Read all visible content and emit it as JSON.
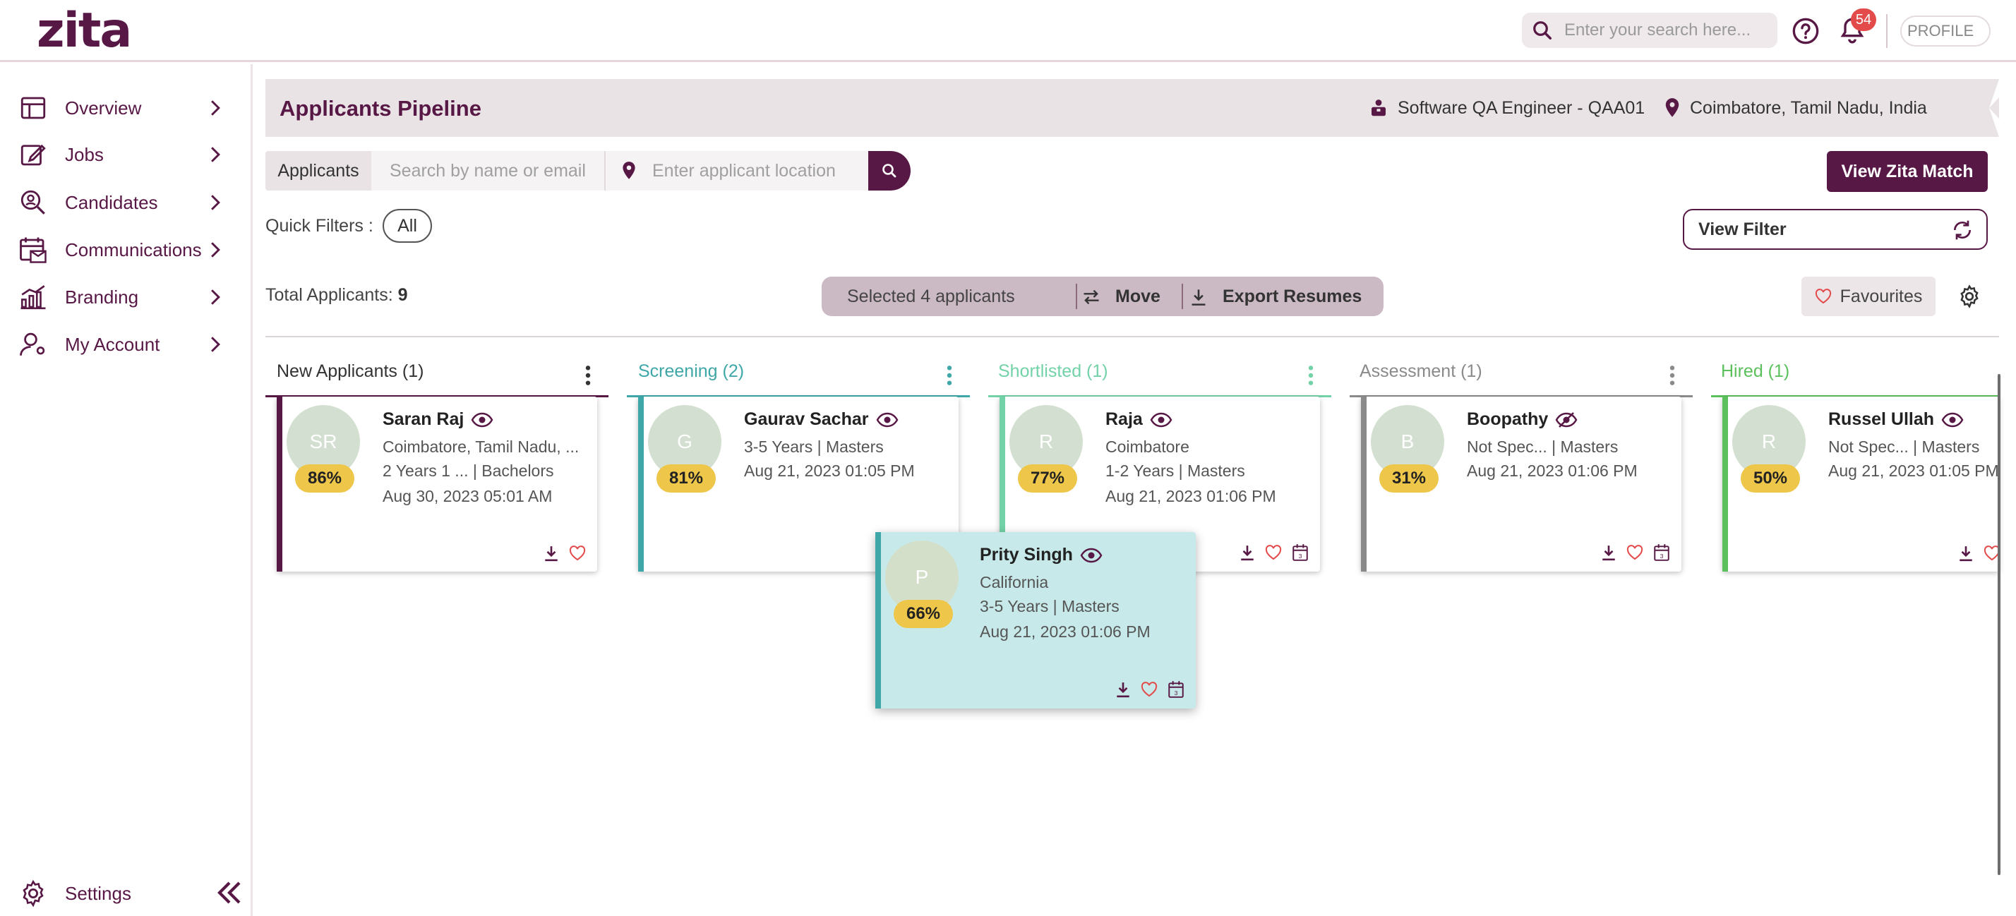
{
  "app": {
    "logo": "zita"
  },
  "topbar": {
    "search_placeholder": "Enter your search here...",
    "notification_count": "54",
    "profile_label": "PROFILE"
  },
  "sidebar": {
    "items": [
      {
        "label": "Overview",
        "icon": "overview-icon"
      },
      {
        "label": "Jobs",
        "icon": "jobs-icon"
      },
      {
        "label": "Candidates",
        "icon": "candidates-icon"
      },
      {
        "label": "Communications",
        "icon": "communications-icon"
      },
      {
        "label": "Branding",
        "icon": "branding-icon"
      },
      {
        "label": "My Account",
        "icon": "account-icon"
      }
    ],
    "settings_label": "Settings"
  },
  "header": {
    "title": "Applicants Pipeline",
    "job": "Software QA Engineer - QAA01",
    "location": "Coimbatore, Tamil Nadu, India"
  },
  "search": {
    "tab_label": "Applicants",
    "name_placeholder": "Search by name or email",
    "location_placeholder": "Enter applicant location"
  },
  "actions": {
    "view_zita_match": "View Zita Match",
    "quick_filters_label": "Quick Filters :",
    "chip_all": "All",
    "view_filter": "View Filter",
    "total_label": "Total Applicants:",
    "total_value": "9",
    "selected_text": "Selected 4 applicants",
    "move": "Move",
    "export": "Export Resumes",
    "favourites": "Favourites"
  },
  "colors": {
    "brand": "#581845",
    "new": "#581845",
    "screening": "#3fa7a7",
    "shortlisted": "#73d2a8",
    "assessment": "#8a8a8a",
    "hired": "#5cc05c",
    "percent_badge": "#eec64a"
  },
  "columns": [
    {
      "title": "New Applicants (1)",
      "color": "#581845"
    },
    {
      "title": "Screening (2)",
      "color": "#3fa7a7"
    },
    {
      "title": "Shortlisted (1)",
      "color": "#73d2a8"
    },
    {
      "title": "Assessment (1)",
      "color": "#8a8a8a"
    },
    {
      "title": "Hired (1)",
      "color": "#5cc05c"
    }
  ],
  "cards": [
    {
      "initials": "SR",
      "percent": "86%",
      "name": "Saran Raj",
      "line1": "Coimbatore, Tamil Nadu, ...",
      "line2": "2 Years 1 ...   | Bachelors",
      "date": "Aug 30, 2023 05:01 AM"
    },
    {
      "initials": "G",
      "percent": "81%",
      "name": "Gaurav Sachar",
      "line1": "3-5 Years | Masters",
      "line2": "Aug 21, 2023 01:05 PM",
      "date": ""
    },
    {
      "initials": "R",
      "percent": "77%",
      "name": "Raja",
      "line1": "Coimbatore",
      "line2": "1-2 Years | Masters",
      "date": "Aug 21, 2023 01:06 PM"
    },
    {
      "initials": "B",
      "percent": "31%",
      "name": "Boopathy",
      "line1": "Not Spec...  | Masters",
      "line2": "Aug 21, 2023 01:06 PM",
      "date": ""
    },
    {
      "initials": "R",
      "percent": "50%",
      "name": "Russel Ullah",
      "line1": "Not Spec...  | Masters",
      "line2": "Aug 21, 2023 01:05 PM",
      "date": ""
    }
  ],
  "dragging_card": {
    "initials": "P",
    "percent": "66%",
    "name": "Prity Singh",
    "line1": "California",
    "line2": "3-5 Years | Masters",
    "date": "Aug 21, 2023 01:06 PM"
  }
}
